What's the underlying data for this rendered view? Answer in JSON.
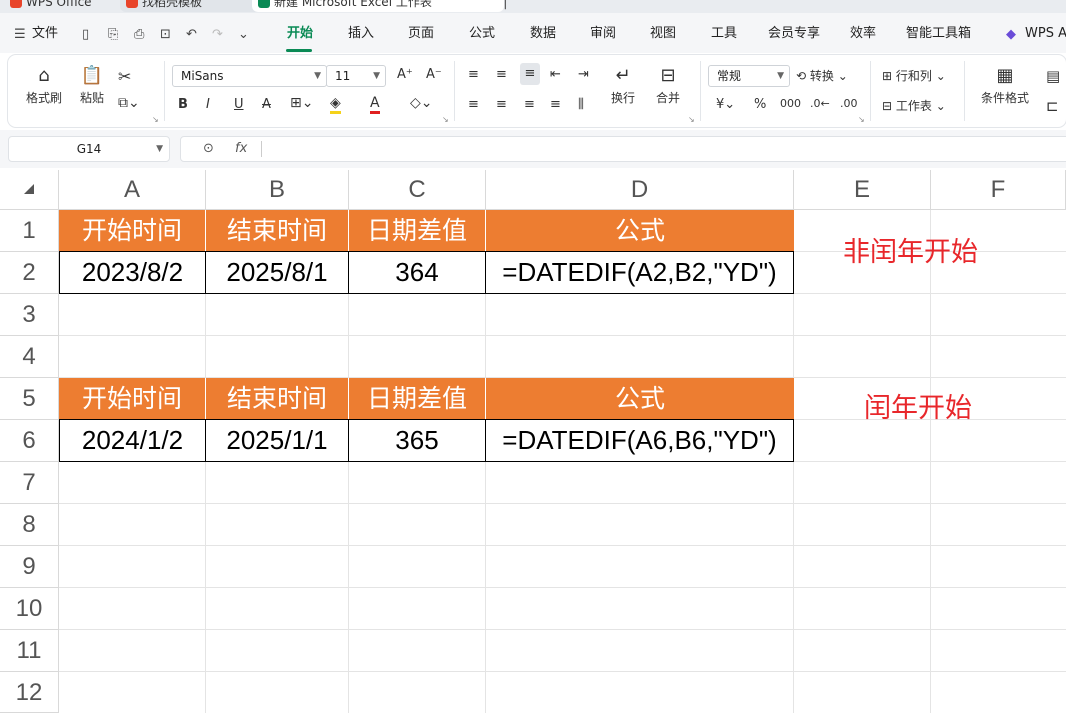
{
  "window_tabs": [
    {
      "label": "WPS Office",
      "color": "#e8442a"
    },
    {
      "label": "找稻壳模板",
      "color": "#e8442a"
    },
    {
      "label": "新建 Microsoft Excel 工作表",
      "color": "#0a8a55"
    }
  ],
  "menu": {
    "file": "文件",
    "items": [
      "开始",
      "插入",
      "页面",
      "公式",
      "数据",
      "审阅",
      "视图",
      "工具",
      "会员专享",
      "效率",
      "智能工具箱",
      "WPS A"
    ],
    "active": "开始"
  },
  "ribbon": {
    "format_painter": "格式刷",
    "paste": "粘贴",
    "font_name": "MiSans",
    "font_size": "11",
    "wrap": "换行",
    "merge": "合并",
    "number_format": "常规",
    "convert": "转换",
    "row_col": "行和列",
    "worksheet": "工作表",
    "cond_format": "条件格式"
  },
  "formula_bar": {
    "name_box": "G14",
    "fx": "fx",
    "formula": ""
  },
  "sheet": {
    "columns": [
      "A",
      "B",
      "C",
      "D",
      "E",
      "F"
    ],
    "rows": [
      "1",
      "2",
      "3",
      "4",
      "5",
      "6",
      "7",
      "8",
      "9",
      "10",
      "11",
      "12"
    ],
    "table1": {
      "headers": [
        "开始时间",
        "结束时间",
        "日期差值",
        "公式"
      ],
      "row": [
        "2023/8/2",
        "2025/8/1",
        "364",
        "=DATEDIF(A2,B2,\"YD\")"
      ],
      "note": "非闰年开始"
    },
    "table2": {
      "headers": [
        "开始时间",
        "结束时间",
        "日期差值",
        "公式"
      ],
      "row": [
        "2024/1/2",
        "2025/1/1",
        "365",
        "=DATEDIF(A6,B6,\"YD\")"
      ],
      "note": "闰年开始"
    },
    "header_color": "#ed7d31",
    "note_color": "#e8272b"
  }
}
